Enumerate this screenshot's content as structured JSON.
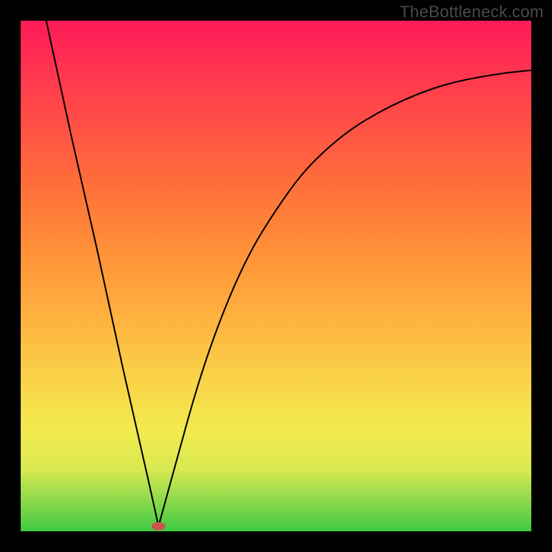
{
  "watermark": "TheBottleneck.com",
  "chart_data": {
    "type": "line",
    "title": "",
    "xlabel": "",
    "ylabel": "",
    "xlim": [
      0,
      100
    ],
    "ylim": [
      0,
      100
    ],
    "series": [
      {
        "name": "left-branch",
        "x": [
          5,
          10,
          15,
          20,
          25,
          27
        ],
        "y": [
          100,
          77,
          55,
          32,
          10,
          1
        ]
      },
      {
        "name": "right-branch",
        "x": [
          27,
          30,
          35,
          40,
          45,
          50,
          55,
          60,
          65,
          70,
          75,
          80,
          85,
          90,
          95,
          100
        ],
        "y": [
          1,
          12,
          30,
          44,
          55,
          63,
          70,
          75,
          79,
          82,
          84.5,
          86.5,
          88,
          89,
          89.8,
          90.3
        ]
      }
    ],
    "background_gradient_stops": [
      {
        "pos": 0.0,
        "color": "#3fca42"
      },
      {
        "pos": 0.06,
        "color": "#8cd94d"
      },
      {
        "pos": 0.12,
        "color": "#d7e94f"
      },
      {
        "pos": 0.2,
        "color": "#f3ea4f"
      },
      {
        "pos": 0.3,
        "color": "#f9d247"
      },
      {
        "pos": 0.42,
        "color": "#feb13f"
      },
      {
        "pos": 0.55,
        "color": "#ff9038"
      },
      {
        "pos": 0.68,
        "color": "#ff6e3a"
      },
      {
        "pos": 0.82,
        "color": "#ff4a48"
      },
      {
        "pos": 1.0,
        "color": "#ff1b58"
      }
    ],
    "marker": {
      "x": 27,
      "y": 1,
      "color": "#c9554e"
    }
  }
}
